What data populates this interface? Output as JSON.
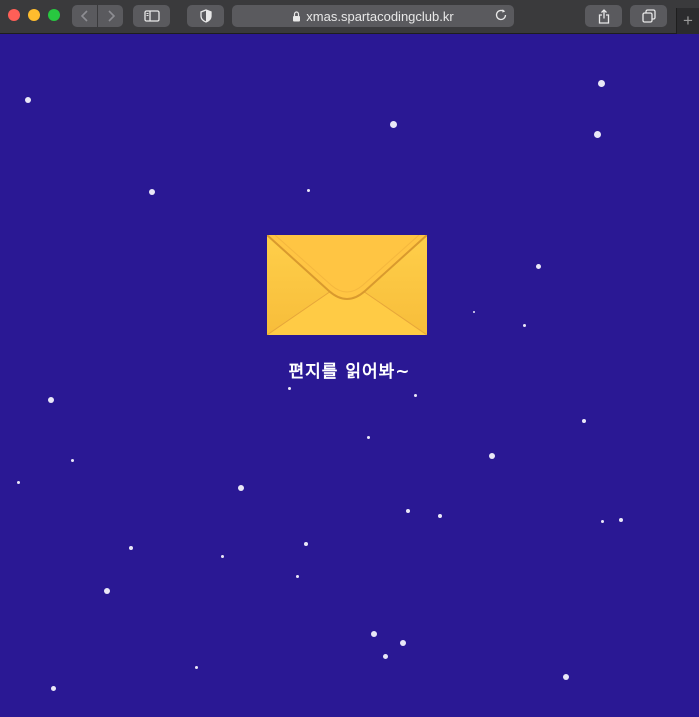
{
  "browser": {
    "url": "xmas.spartacodingclub.kr",
    "new_tab_label": "+",
    "icons": {
      "back": "chevron-left-icon",
      "forward": "chevron-right-icon",
      "sidebar": "sidebar-icon",
      "shield": "shield-icon",
      "lock": "lock-icon",
      "reload": "reload-icon",
      "share": "share-icon",
      "tabs": "tabs-overview-icon"
    }
  },
  "page": {
    "background_color": "#2a1894",
    "envelope_color": "#ffcb45",
    "caption": "편지를 읽어봐~"
  }
}
